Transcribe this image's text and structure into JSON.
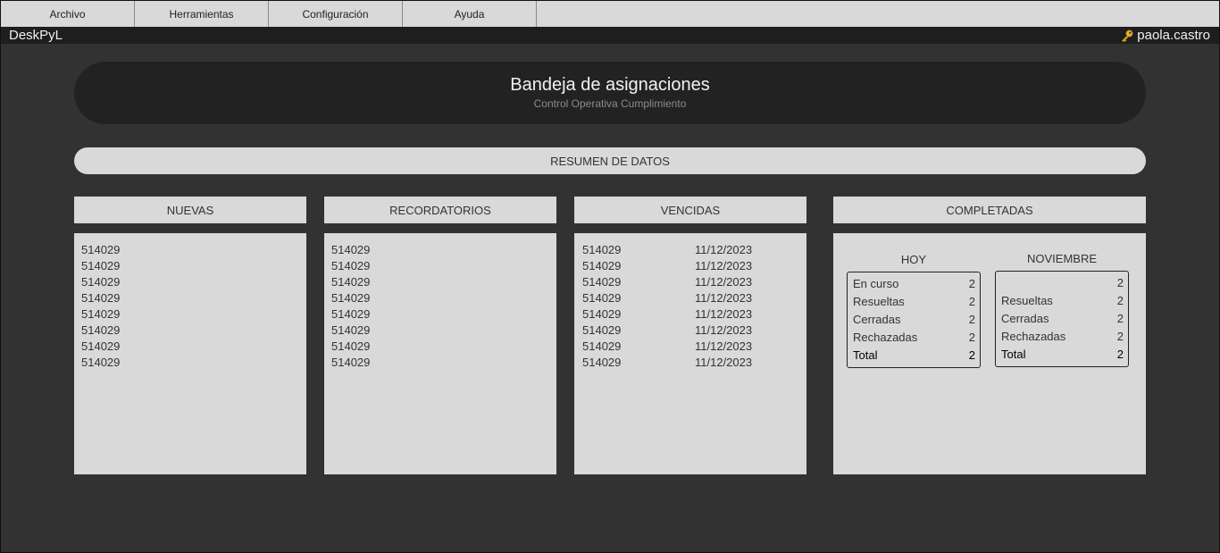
{
  "menubar": {
    "items": [
      "Archivo",
      "Herramientas",
      "Configuración",
      "Ayuda"
    ]
  },
  "app": {
    "name": "DeskPyL",
    "user": "paola.castro"
  },
  "header": {
    "title": "Bandeja de asignaciones",
    "subtitle": "Control Operativa Cumplimiento"
  },
  "summary": {
    "label": "RESUMEN DE DATOS"
  },
  "panels": {
    "nuevas": {
      "title": "NUEVAS",
      "items": [
        "514029",
        "514029",
        "514029",
        "514029",
        "514029",
        "514029",
        "514029",
        "514029"
      ]
    },
    "recordatorios": {
      "title": "RECORDATORIOS",
      "items": [
        "514029",
        "514029",
        "514029",
        "514029",
        "514029",
        "514029",
        "514029",
        "514029"
      ]
    },
    "vencidas": {
      "title": "VENCIDAS",
      "items": [
        {
          "id": "514029",
          "date": "11/12/2023"
        },
        {
          "id": "514029",
          "date": "11/12/2023"
        },
        {
          "id": "514029",
          "date": "11/12/2023"
        },
        {
          "id": "514029",
          "date": "11/12/2023"
        },
        {
          "id": "514029",
          "date": "11/12/2023"
        },
        {
          "id": "514029",
          "date": "11/12/2023"
        },
        {
          "id": "514029",
          "date": "11/12/2023"
        },
        {
          "id": "514029",
          "date": "11/12/2023"
        }
      ]
    },
    "completadas": {
      "title": "COMPLETADAS",
      "hoy": {
        "label": "HOY",
        "rows": [
          {
            "k": "En curso",
            "v": "2"
          },
          {
            "k": "Resueltas",
            "v": "2"
          },
          {
            "k": "Cerradas",
            "v": "2"
          },
          {
            "k": "Rechazadas",
            "v": "2"
          },
          {
            "k": "Total",
            "v": "2"
          }
        ]
      },
      "mes": {
        "label": "NOVIEMBRE",
        "rows": [
          {
            "k": "",
            "v": "2"
          },
          {
            "k": "Resueltas",
            "v": "2"
          },
          {
            "k": "Cerradas",
            "v": "2"
          },
          {
            "k": "Rechazadas",
            "v": "2"
          },
          {
            "k": "Total",
            "v": "2"
          }
        ]
      }
    }
  }
}
